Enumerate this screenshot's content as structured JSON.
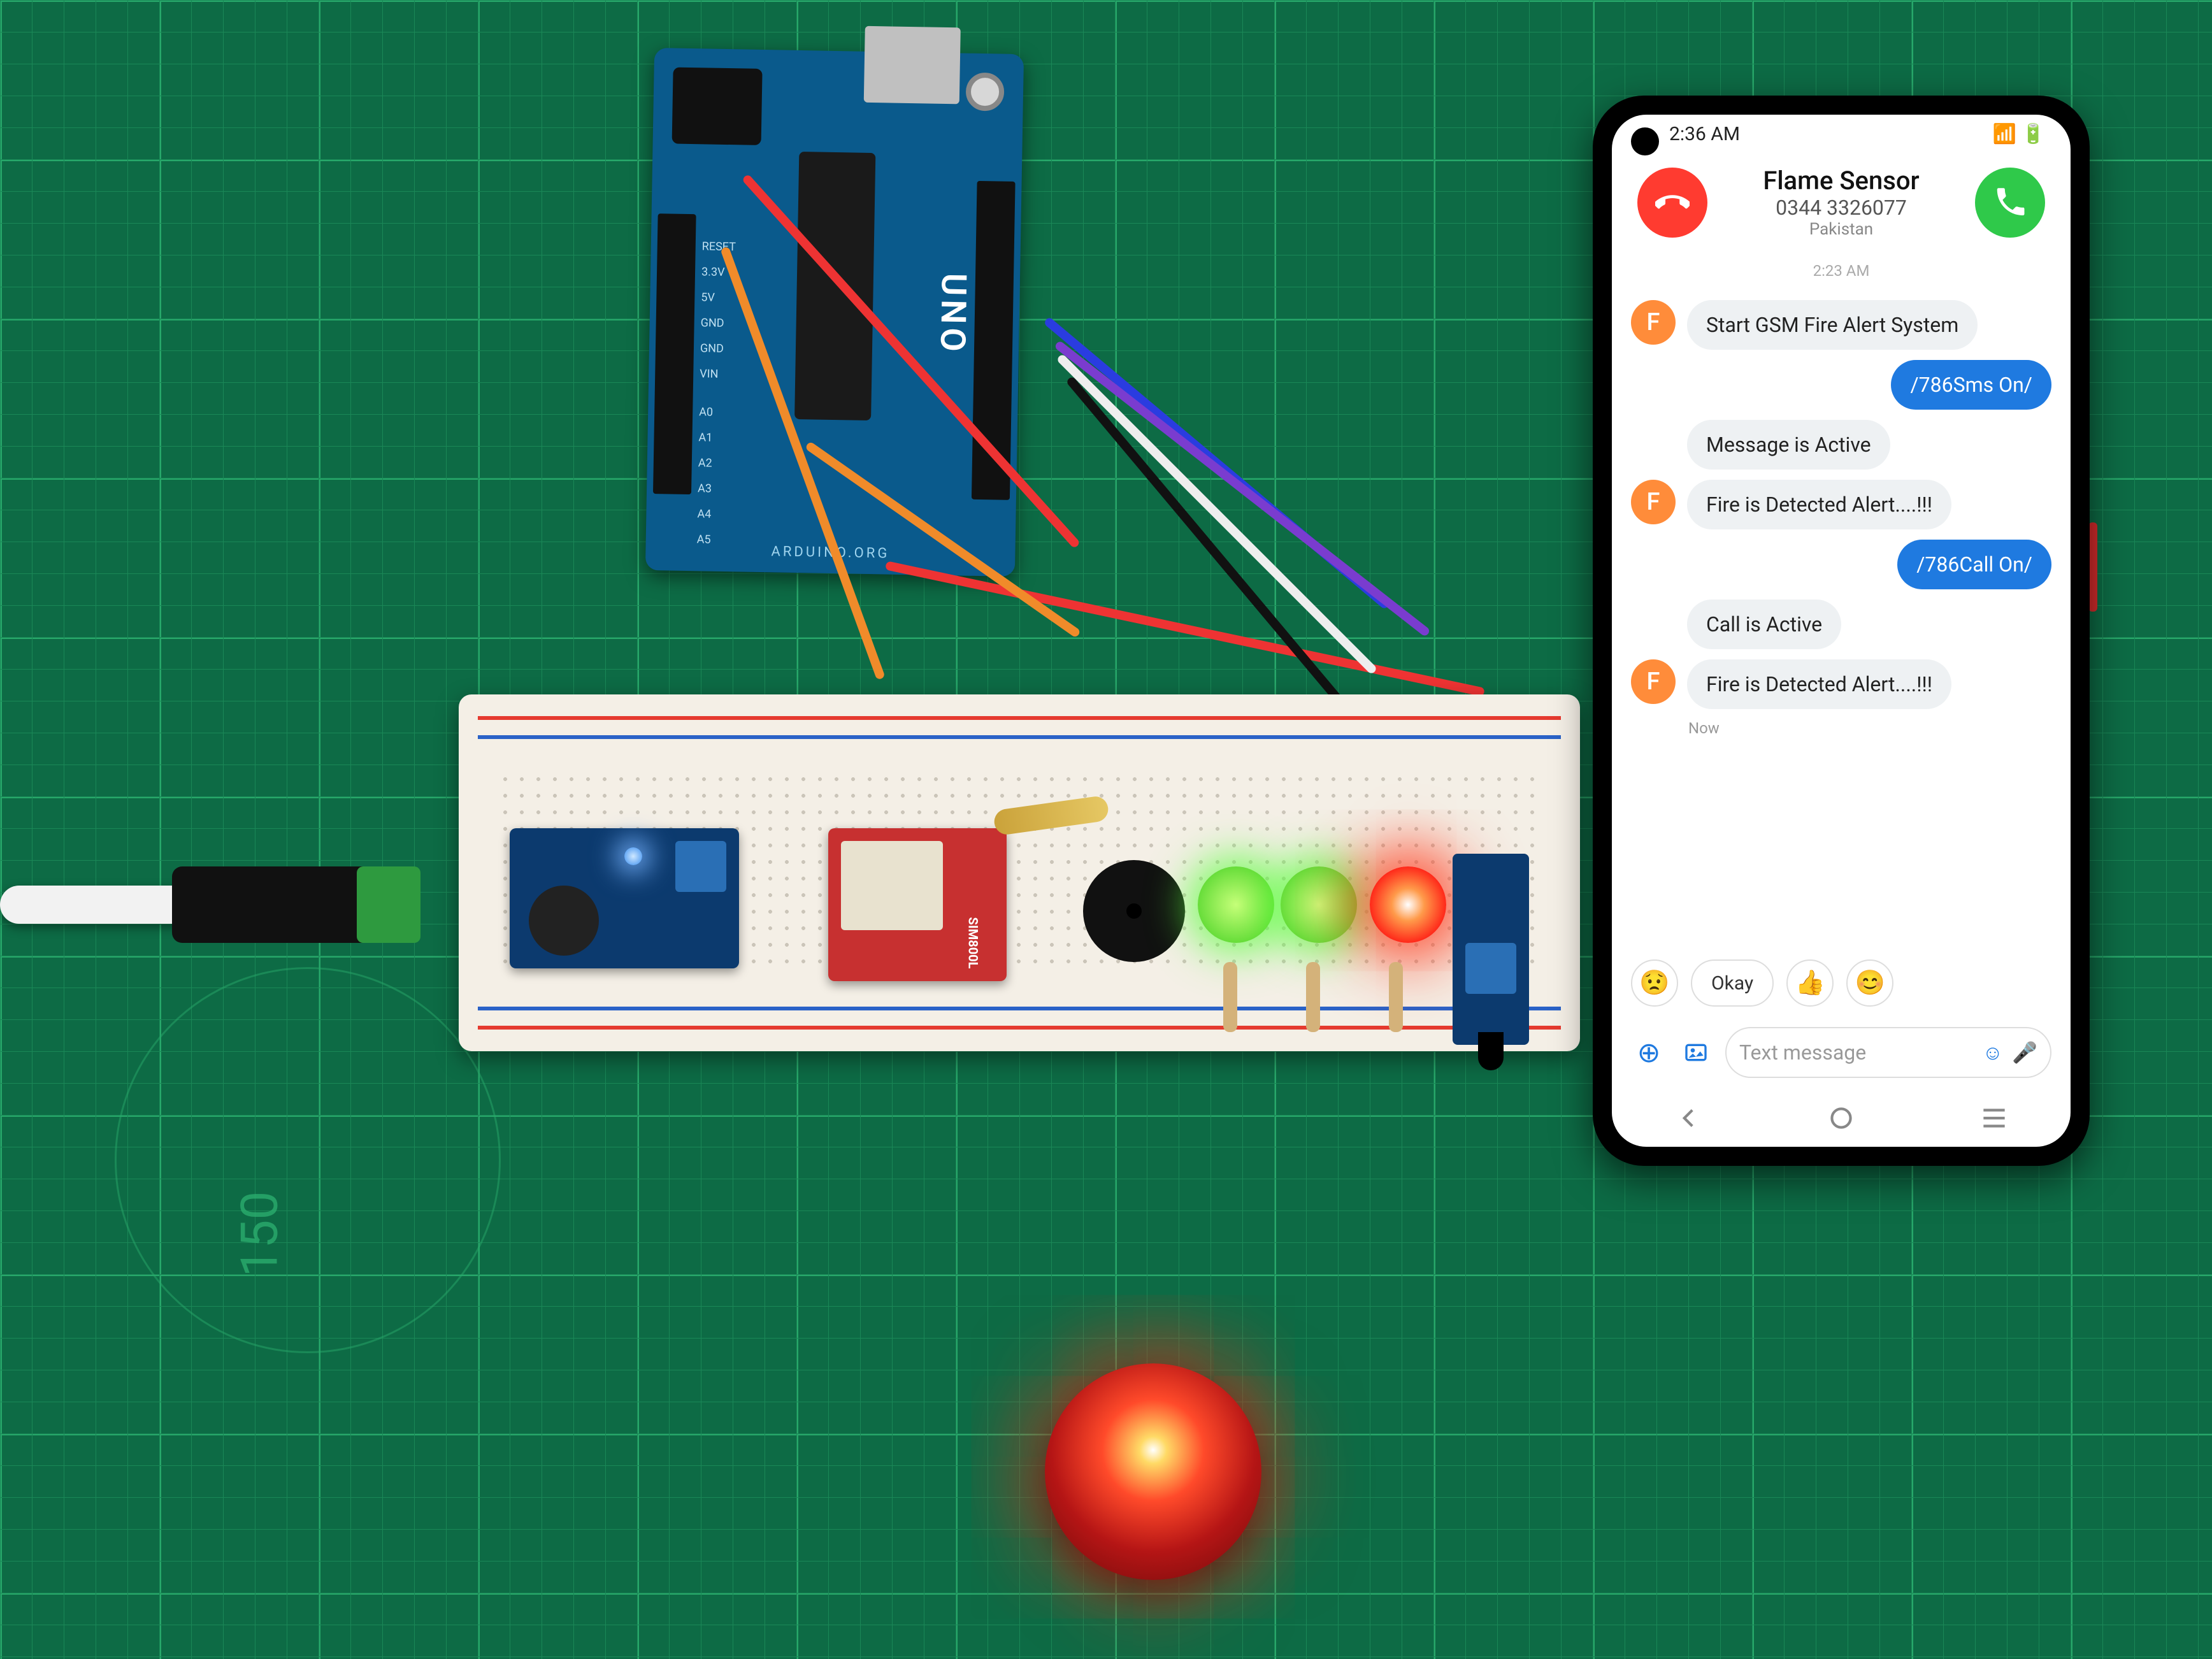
{
  "mat": {
    "ruler_mark": "150"
  },
  "arduino": {
    "title": "UNO",
    "sub": "ARDUINO.ORG",
    "pin_labels": [
      "RESET",
      "3.3V",
      "5V",
      "GND",
      "GND",
      "VIN",
      "A0",
      "A1",
      "A2",
      "A3",
      "A4",
      "A5"
    ]
  },
  "sim_module": {
    "label": "SIM800L"
  },
  "phone": {
    "status": {
      "time": "2:36 AM",
      "icons": "📶 🔋"
    },
    "caller": {
      "name": "Flame Sensor",
      "number": "0344 3326077",
      "location": "Pakistan"
    },
    "thread_time": "2:23 AM",
    "avatar_initial": "F",
    "messages": [
      {
        "dir": "in",
        "text": "Start GSM Fire Alert System",
        "avatar": true
      },
      {
        "dir": "out",
        "text": "/786Sms On/"
      },
      {
        "dir": "in",
        "text": "Message is Active"
      },
      {
        "dir": "in",
        "text": "Fire is Detected Alert....!!!",
        "avatar": true
      },
      {
        "dir": "out",
        "text": "/786Call On/"
      },
      {
        "dir": "in",
        "text": "Call is Active"
      },
      {
        "dir": "in",
        "text": "Fire is Detected Alert....!!!",
        "avatar": true
      }
    ],
    "timestamp_label": "Now",
    "suggestions": [
      "😟",
      "Okay",
      "👍",
      "😊"
    ],
    "composer": {
      "placeholder": "Text message"
    }
  }
}
